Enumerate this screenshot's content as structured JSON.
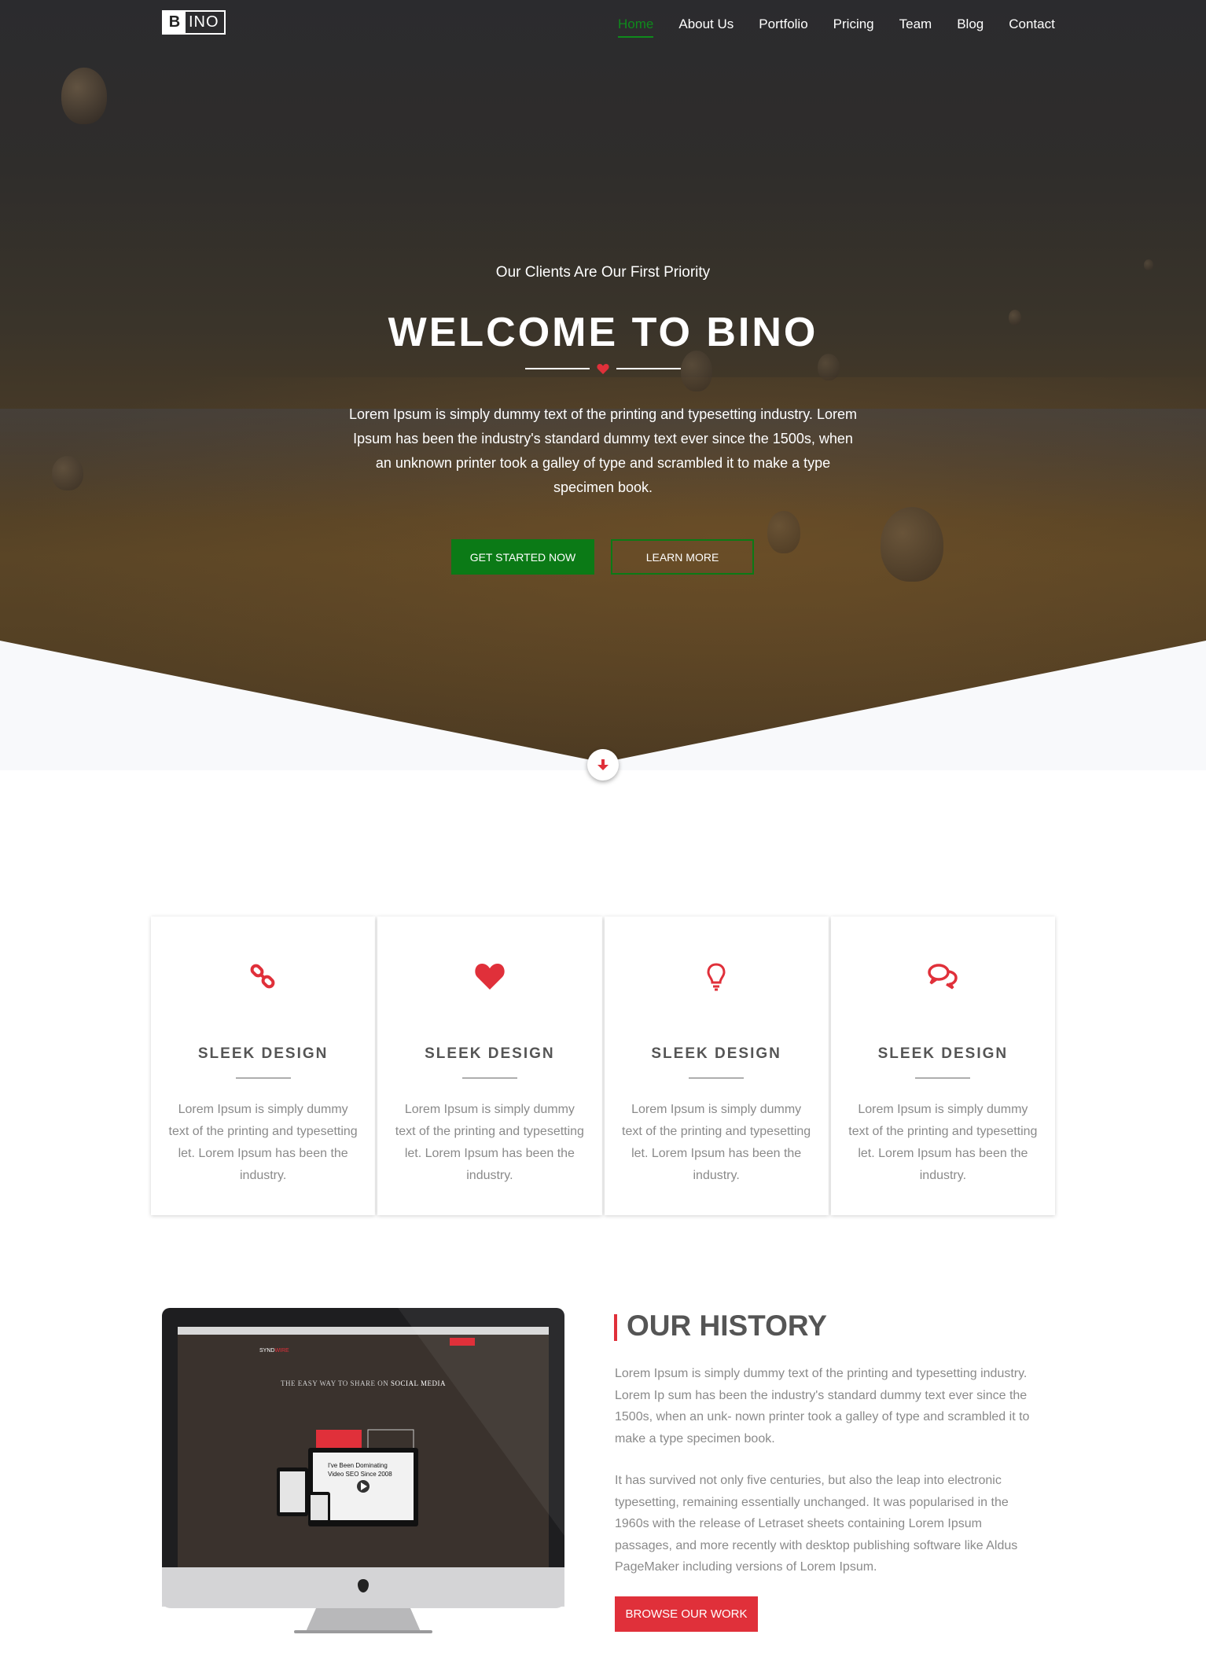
{
  "brand": {
    "logo_letter": "B",
    "logo_rest": "INO"
  },
  "nav": {
    "items": [
      {
        "label": "Home",
        "active": true
      },
      {
        "label": "About Us"
      },
      {
        "label": "Portfolio"
      },
      {
        "label": "Pricing"
      },
      {
        "label": "Team"
      },
      {
        "label": "Blog"
      },
      {
        "label": "Contact"
      }
    ]
  },
  "hero": {
    "subtitle": "Our Clients Are Our First Priority",
    "title": "WELCOME TO BINO",
    "text": "Lorem Ipsum is simply dummy text of the printing and typesetting industry. Lorem Ipsum has been the industry's standard dummy text ever since the 1500s, when an unknown printer took a galley of type and scrambled it to make a type specimen book.",
    "primary_button": "GET STARTED NOW",
    "secondary_button": "LEARN MORE",
    "scroll_icon": "arrow-down-icon"
  },
  "features": [
    {
      "icon": "link-icon",
      "title": "SLEEK DESIGN",
      "text": "Lorem Ipsum is simply dummy text of the printing and typesetting let. Lorem Ipsum has been the industry."
    },
    {
      "icon": "heart-icon",
      "title": "SLEEK DESIGN",
      "text": "Lorem Ipsum is simply dummy text of the printing and typesetting let. Lorem Ipsum has been the industry."
    },
    {
      "icon": "lightbulb-icon",
      "title": "SLEEK DESIGN",
      "text": "Lorem Ipsum is simply dummy text of the printing and typesetting let. Lorem Ipsum has been the industry."
    },
    {
      "icon": "comments-icon",
      "title": "SLEEK DESIGN",
      "text": "Lorem Ipsum is simply dummy text of the printing and typesetting let. Lorem Ipsum has been the industry."
    }
  ],
  "history": {
    "title": "OUR HISTORY",
    "p1": "Lorem Ipsum is simply dummy text of the printing and typesetting industry. Lorem Ip sum has been the industry's standard dummy text ever since the 1500s, when an unk- nown printer took a galley of type and scrambled it to make a type specimen book.",
    "p2": "It has survived not only five centuries, but also the leap into electronic typesetting, remaining essentially unchanged. It was popularised in the 1960s with the release of Letraset sheets containing Lorem Ipsum passages, and more recently with desktop publishing software like Aldus PageMaker including versions of Lorem Ipsum.",
    "button": "BROWSE OUR WORK",
    "screen": {
      "brand_a": "SYND",
      "brand_b": "WIRE",
      "tagline_a": "THE EASY WAY TO SHARE ON ",
      "tagline_b": "SOCIAL MEDIA",
      "video_text_1": "I've Been Dominating",
      "video_text_2": "Video SEO Since 2008"
    }
  },
  "colors": {
    "accent_red": "#e0303a",
    "accent_green": "#0b7a16",
    "text_gray": "#8a8a8a"
  }
}
